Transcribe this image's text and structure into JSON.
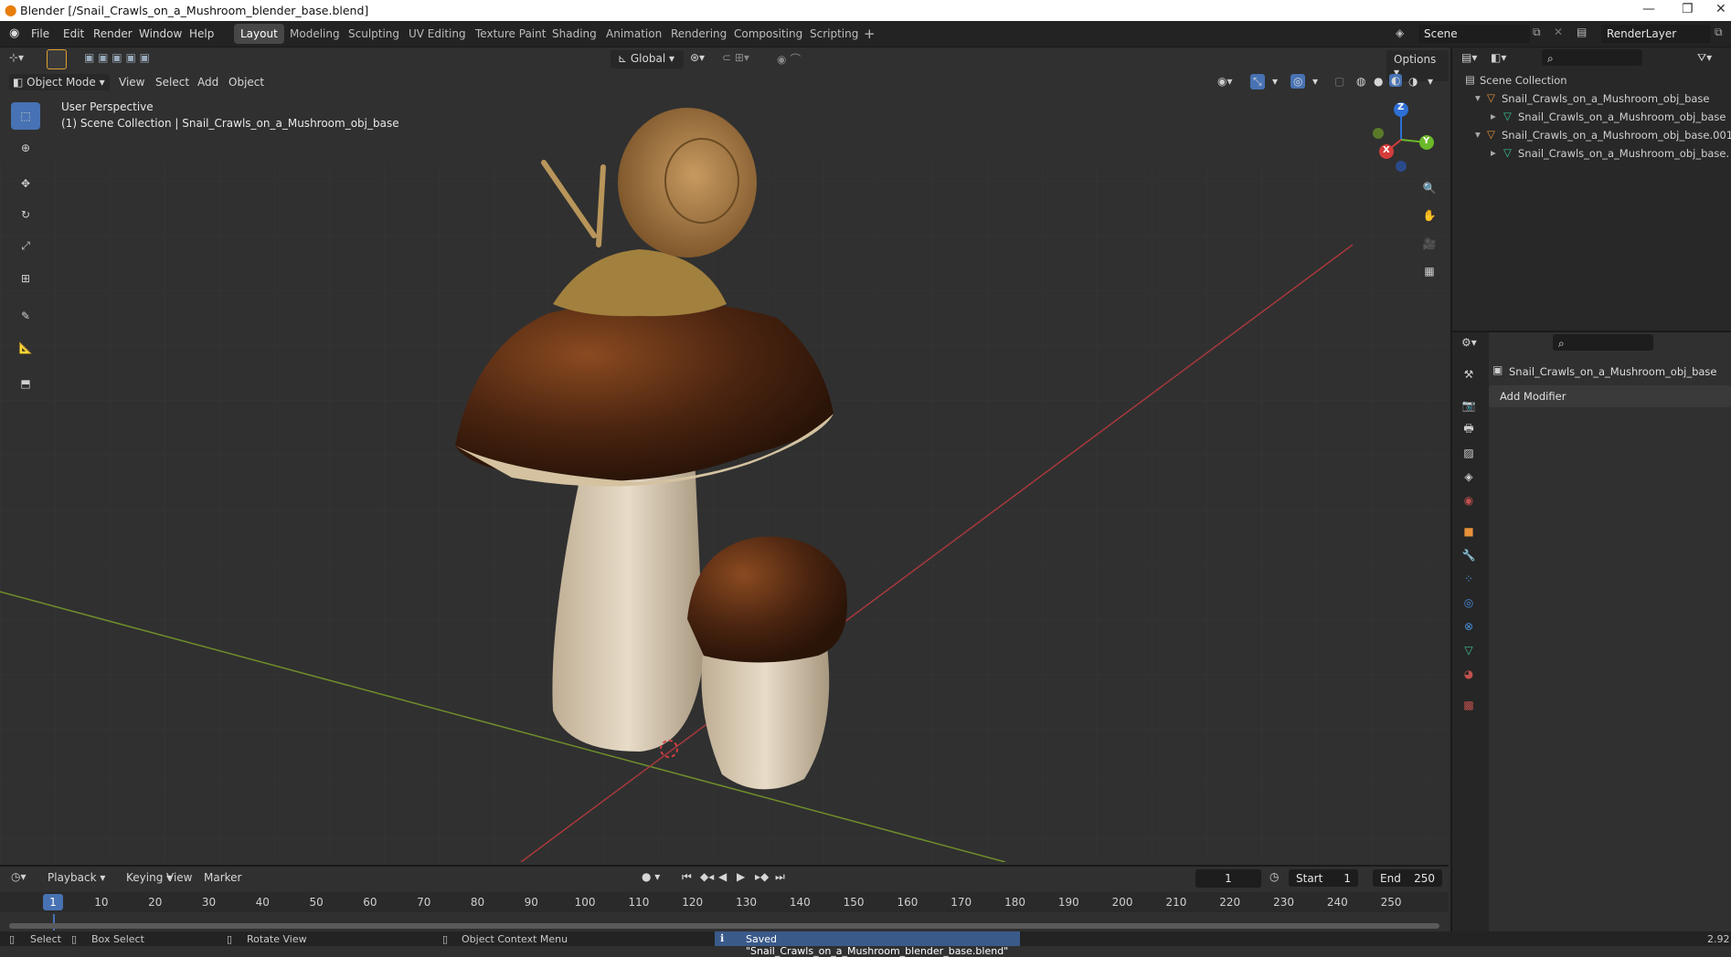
{
  "window": {
    "title": "Blender [/Snail_Crawls_on_a_Mushroom_blender_base.blend]"
  },
  "menus": [
    "File",
    "Edit",
    "Render",
    "Window",
    "Help"
  ],
  "workspaces": [
    "Layout",
    "Modeling",
    "Sculpting",
    "UV Editing",
    "Texture Paint",
    "Shading",
    "Animation",
    "Rendering",
    "Compositing",
    "Scripting"
  ],
  "active_workspace": "Layout",
  "scene": {
    "name": "Scene",
    "render_layer": "RenderLayer"
  },
  "toolbar": {
    "orientation": "Global",
    "options": "Options"
  },
  "viewport_header": {
    "mode": "Object Mode",
    "view": "View",
    "select": "Select",
    "add": "Add",
    "object": "Object"
  },
  "viewport": {
    "perspective": "User Perspective",
    "collection_info": "(1) Scene Collection | Snail_Crawls_on_a_Mushroom_obj_base"
  },
  "gizmo": {
    "x": "X",
    "y": "Y",
    "z": "Z"
  },
  "outliner": {
    "root": "Scene Collection",
    "items": [
      {
        "name": "Snail_Crawls_on_a_Mushroom_obj_base",
        "level": 1
      },
      {
        "name": "Snail_Crawls_on_a_Mushroom_obj_base",
        "level": 2
      },
      {
        "name": "Snail_Crawls_on_a_Mushroom_obj_base.001",
        "level": 1
      },
      {
        "name": "Snail_Crawls_on_a_Mushroom_obj_base.",
        "level": 2
      }
    ]
  },
  "properties": {
    "object_name": "Snail_Crawls_on_a_Mushroom_obj_base",
    "add_modifier": "Add Modifier"
  },
  "timeline": {
    "playback": "Playback",
    "keying": "Keying",
    "view": "View",
    "marker": "Marker",
    "current_frame": "1",
    "start_label": "Start",
    "start": "1",
    "end_label": "End",
    "end": "250",
    "ticks": [
      "1",
      "10",
      "20",
      "30",
      "40",
      "50",
      "60",
      "70",
      "80",
      "90",
      "100",
      "110",
      "120",
      "130",
      "140",
      "150",
      "160",
      "170",
      "180",
      "190",
      "200",
      "210",
      "220",
      "230",
      "240",
      "250"
    ]
  },
  "status": {
    "select": "Select",
    "box_select": "Box Select",
    "rotate_view": "Rotate View",
    "context_menu": "Object Context Menu",
    "message": "Saved \"Snail_Crawls_on_a_Mushroom_blender_base.blend\"",
    "version": "2.92"
  }
}
